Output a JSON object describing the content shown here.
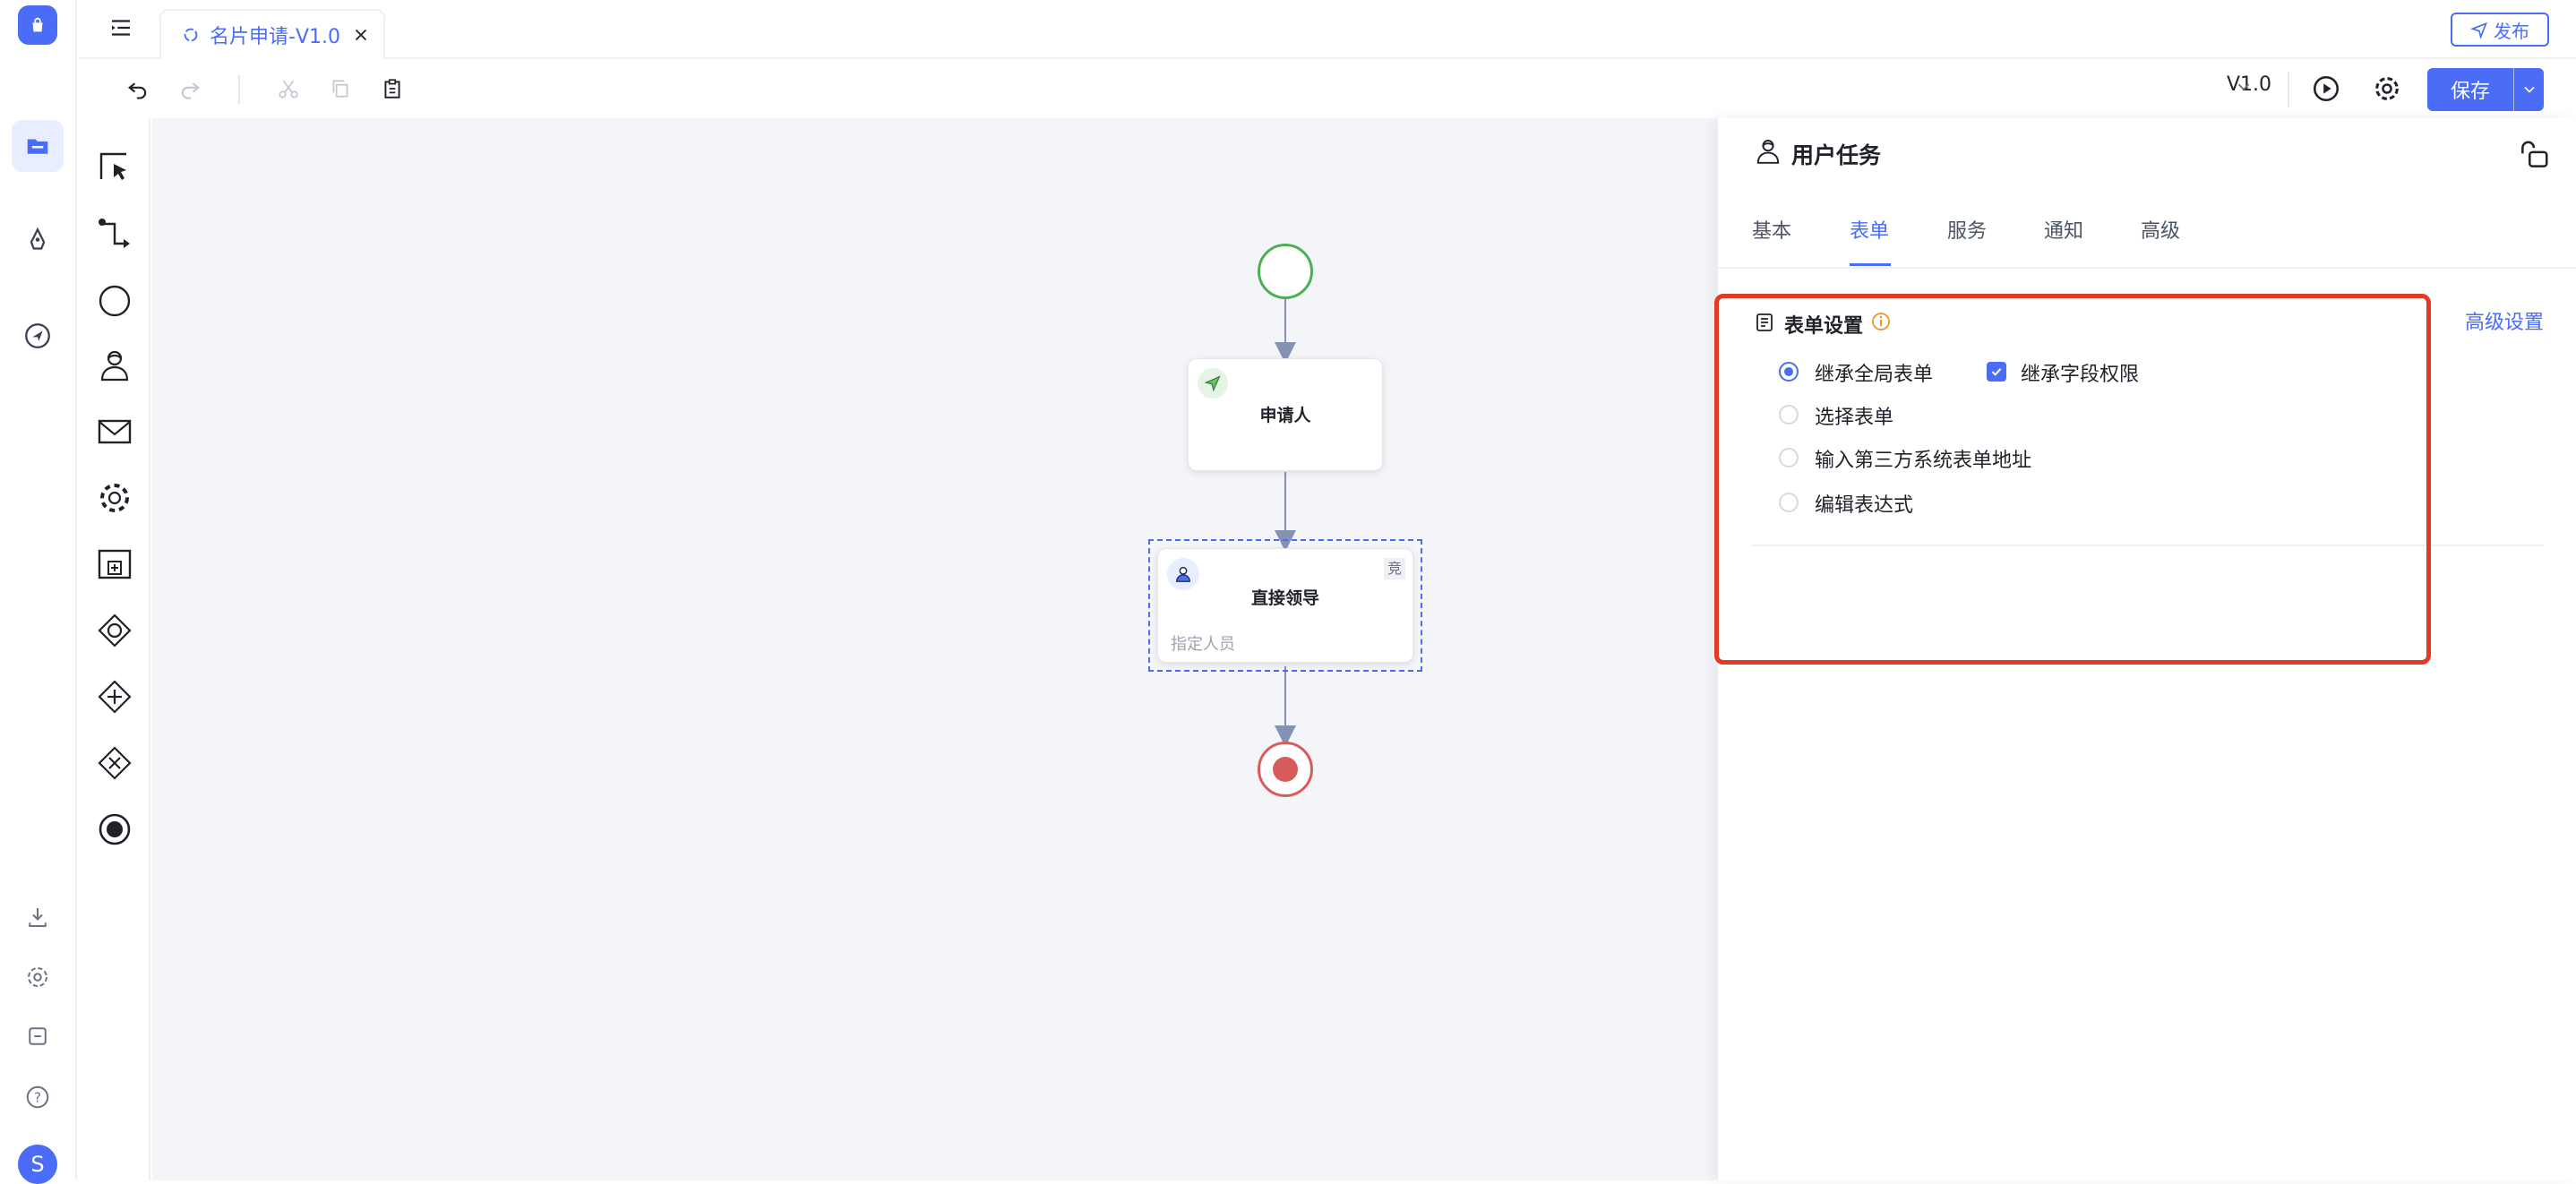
{
  "app": {
    "avatar_letter": "S",
    "accent": "#4a6cf7"
  },
  "tab": {
    "title": "名片申请-V1.0"
  },
  "topbar": {
    "publish_label": "发布"
  },
  "toolbar": {
    "version": "V1.0",
    "save_label": "保存"
  },
  "diagram": {
    "applicant_node": {
      "label": "申请人"
    },
    "leader_node": {
      "label": "直接领导",
      "sub": "指定人员",
      "badge": "竞"
    }
  },
  "panel": {
    "title": "用户任务",
    "tabs": [
      {
        "label": "基本"
      },
      {
        "label": "表单"
      },
      {
        "label": "服务"
      },
      {
        "label": "通知"
      },
      {
        "label": "高级"
      }
    ],
    "active_tab": "表单",
    "form_settings": {
      "heading": "表单设置",
      "advanced_link": "高级设置",
      "options": [
        {
          "label": "继承全局表单",
          "selected": true
        },
        {
          "label": "选择表单",
          "selected": false
        },
        {
          "label": "输入第三方系统表单地址",
          "selected": false
        },
        {
          "label": "编辑表达式",
          "selected": false
        }
      ],
      "inherit_field_permissions": {
        "label": "继承字段权限",
        "checked": true
      }
    }
  },
  "colors": {
    "highlight_box": "#e03b24",
    "start_event": "#4caf50",
    "end_event": "#d95c5c"
  }
}
